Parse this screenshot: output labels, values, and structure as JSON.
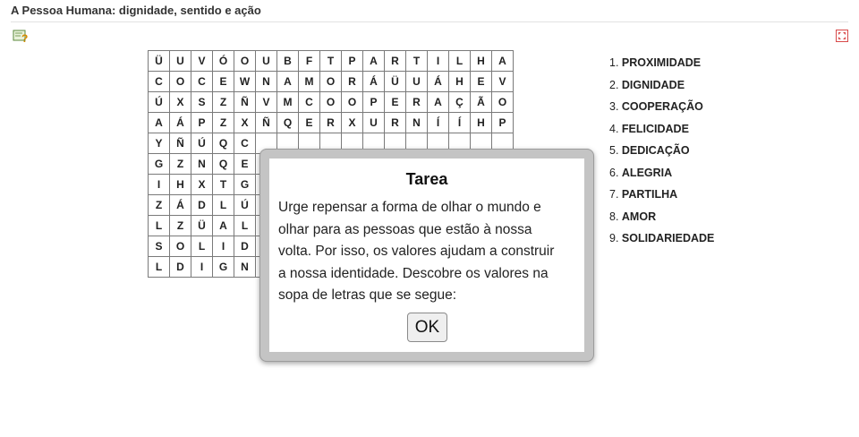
{
  "page": {
    "title": "A Pessoa Humana: dignidade, sentido e ação"
  },
  "icons": {
    "help": "help-question-icon",
    "fullscreen": "fullscreen-icon"
  },
  "grid": {
    "rows": [
      [
        "Ü",
        "U",
        "V",
        "Ó",
        "O",
        "U",
        "B",
        "F",
        "T",
        "P",
        "A",
        "R",
        "T",
        "I",
        "L",
        "H",
        "A"
      ],
      [
        "C",
        "O",
        "C",
        "E",
        "W",
        "N",
        "A",
        "M",
        "O",
        "R",
        "Á",
        "Ü",
        "U",
        "Á",
        "H",
        "E",
        "V"
      ],
      [
        "Ú",
        "X",
        "S",
        "Z",
        "Ñ",
        "V",
        "M",
        "C",
        "O",
        "O",
        "P",
        "E",
        "R",
        "A",
        "Ç",
        "Ã",
        "O"
      ],
      [
        "A",
        "Á",
        "P",
        "Z",
        "X",
        "Ñ",
        "Q",
        "E",
        "R",
        "X",
        "U",
        "R",
        "N",
        "Í",
        "Í",
        "H",
        "P"
      ],
      [
        "Y",
        "Ñ",
        "Ú",
        "Q",
        "C",
        "",
        "",
        "",
        "",
        "",
        "",
        "",
        "",
        "",
        "",
        "",
        ""
      ],
      [
        "G",
        "Z",
        "N",
        "Q",
        "E",
        "",
        "",
        "",
        "",
        "",
        "",
        "",
        "",
        "",
        "",
        "",
        ""
      ],
      [
        "I",
        "H",
        "X",
        "T",
        "G",
        "",
        "",
        "",
        "",
        "",
        "",
        "",
        "",
        "",
        "",
        "",
        ""
      ],
      [
        "Z",
        "Á",
        "D",
        "L",
        "Ú",
        "",
        "",
        "",
        "",
        "",
        "",
        "",
        "",
        "",
        "",
        "",
        ""
      ],
      [
        "L",
        "Z",
        "Ü",
        "A",
        "L",
        "",
        "",
        "",
        "",
        "",
        "",
        "",
        "",
        "",
        "",
        "",
        ""
      ],
      [
        "S",
        "O",
        "L",
        "I",
        "D",
        "",
        "",
        "",
        "",
        "",
        "",
        "",
        "",
        "",
        "",
        "",
        ""
      ],
      [
        "L",
        "D",
        "I",
        "G",
        "N",
        "",
        "",
        "",
        "",
        "",
        "",
        "",
        "",
        "",
        "",
        "",
        ""
      ]
    ]
  },
  "words": [
    {
      "num": "1.",
      "word": "PROXIMIDADE"
    },
    {
      "num": "2.",
      "word": "DIGNIDADE"
    },
    {
      "num": "3.",
      "word": "COOPERAÇÃO"
    },
    {
      "num": "4.",
      "word": "FELICIDADE"
    },
    {
      "num": "5.",
      "word": "DEDICAÇÃO"
    },
    {
      "num": "6.",
      "word": "ALEGRIA"
    },
    {
      "num": "7.",
      "word": "PARTILHA"
    },
    {
      "num": "8.",
      "word": "AMOR"
    },
    {
      "num": "9.",
      "word": "SOLIDARIEDADE"
    }
  ],
  "dialog": {
    "title": "Tarea",
    "lines": [
      "Urge repensar a forma de olhar o mundo e",
      "olhar para as pessoas que estão à nossa",
      "volta. Por isso, os valores ajudam a construir",
      "a nossa identidade. Descobre os valores na",
      "sopa de letras que se segue:"
    ],
    "ok_label": "OK"
  }
}
